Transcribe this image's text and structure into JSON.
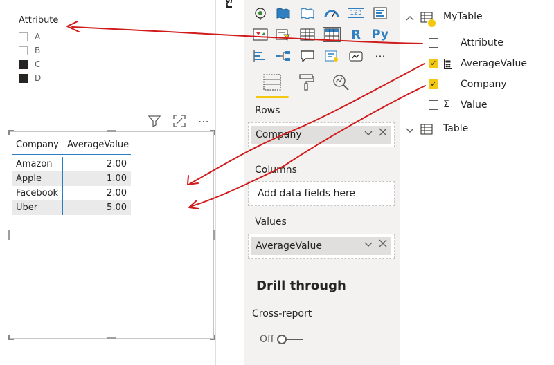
{
  "slicer": {
    "title": "Attribute",
    "items": [
      {
        "label": "A",
        "checked": false
      },
      {
        "label": "B",
        "checked": false
      },
      {
        "label": "C",
        "checked": true
      },
      {
        "label": "D",
        "checked": true
      }
    ]
  },
  "visual_header": {
    "filter_icon": "filter-icon",
    "focus_icon": "focus-mode-icon",
    "more_icon": "more-options-icon",
    "more_glyph": "⋯"
  },
  "matrix": {
    "headers": [
      "Company",
      "AverageValue"
    ],
    "rows": [
      {
        "company": "Amazon",
        "value": "2.00"
      },
      {
        "company": "Apple",
        "value": "1.00"
      },
      {
        "company": "Facebook",
        "value": "2.00"
      },
      {
        "company": "Uber",
        "value": "5.00"
      }
    ]
  },
  "visualizations": {
    "clipped_title": "rs",
    "gallery_text": {
      "r": "R",
      "py": "Py",
      "num": "123",
      "more": "···"
    },
    "tabs": [
      "fields-tab-icon",
      "format-paintroller-icon",
      "analytics-magnifier-icon"
    ],
    "rows_label": "Rows",
    "rows_field": "Company",
    "columns_label": "Columns",
    "columns_placeholder": "Add data fields here",
    "values_label": "Values",
    "values_field": "AverageValue",
    "drill_through": "Drill through",
    "cross_report": "Cross-report",
    "toggle_label": "Off"
  },
  "fields": {
    "tables": [
      {
        "name": "MyTable",
        "expanded": true
      },
      {
        "name": "Table",
        "expanded": false
      }
    ],
    "items": [
      {
        "name": "Attribute",
        "checked": false,
        "type": ""
      },
      {
        "name": "AverageValue",
        "checked": true,
        "type": "calculator"
      },
      {
        "name": "Company",
        "checked": true,
        "type": ""
      },
      {
        "name": "Value",
        "checked": false,
        "type": "sigma"
      }
    ],
    "sigma_glyph": "Σ",
    "check_glyph": "✓"
  },
  "colors": {
    "accent": "#f2c811",
    "annotation": "#d11a1a",
    "matrix_rule": "#2b7ec1"
  }
}
